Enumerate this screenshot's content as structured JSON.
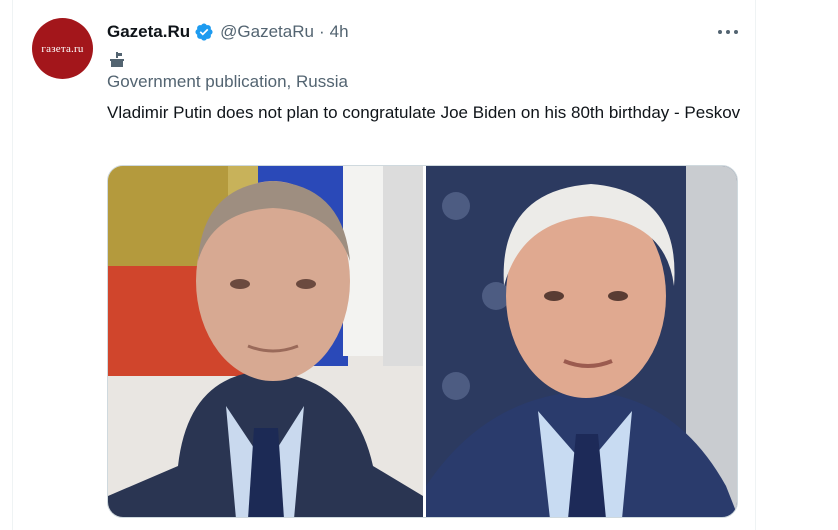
{
  "tweet": {
    "author_name": "Gazeta.Ru",
    "handle": "@GazetaRu",
    "separator": "·",
    "time": "4h",
    "avatar_text": "газета.ru",
    "affiliation": "Government publication, Russia",
    "text": "Vladimir Putin does not plan to congratulate Joe Biden on his 80th birthday - Peskov"
  },
  "icons": {
    "verified": "verified-badge-icon",
    "government": "government-podium-icon",
    "more": "more-options-icon"
  },
  "colors": {
    "brand_red": "#a3161b",
    "verified_blue": "#1d9bf0",
    "secondary_text": "#536471"
  }
}
